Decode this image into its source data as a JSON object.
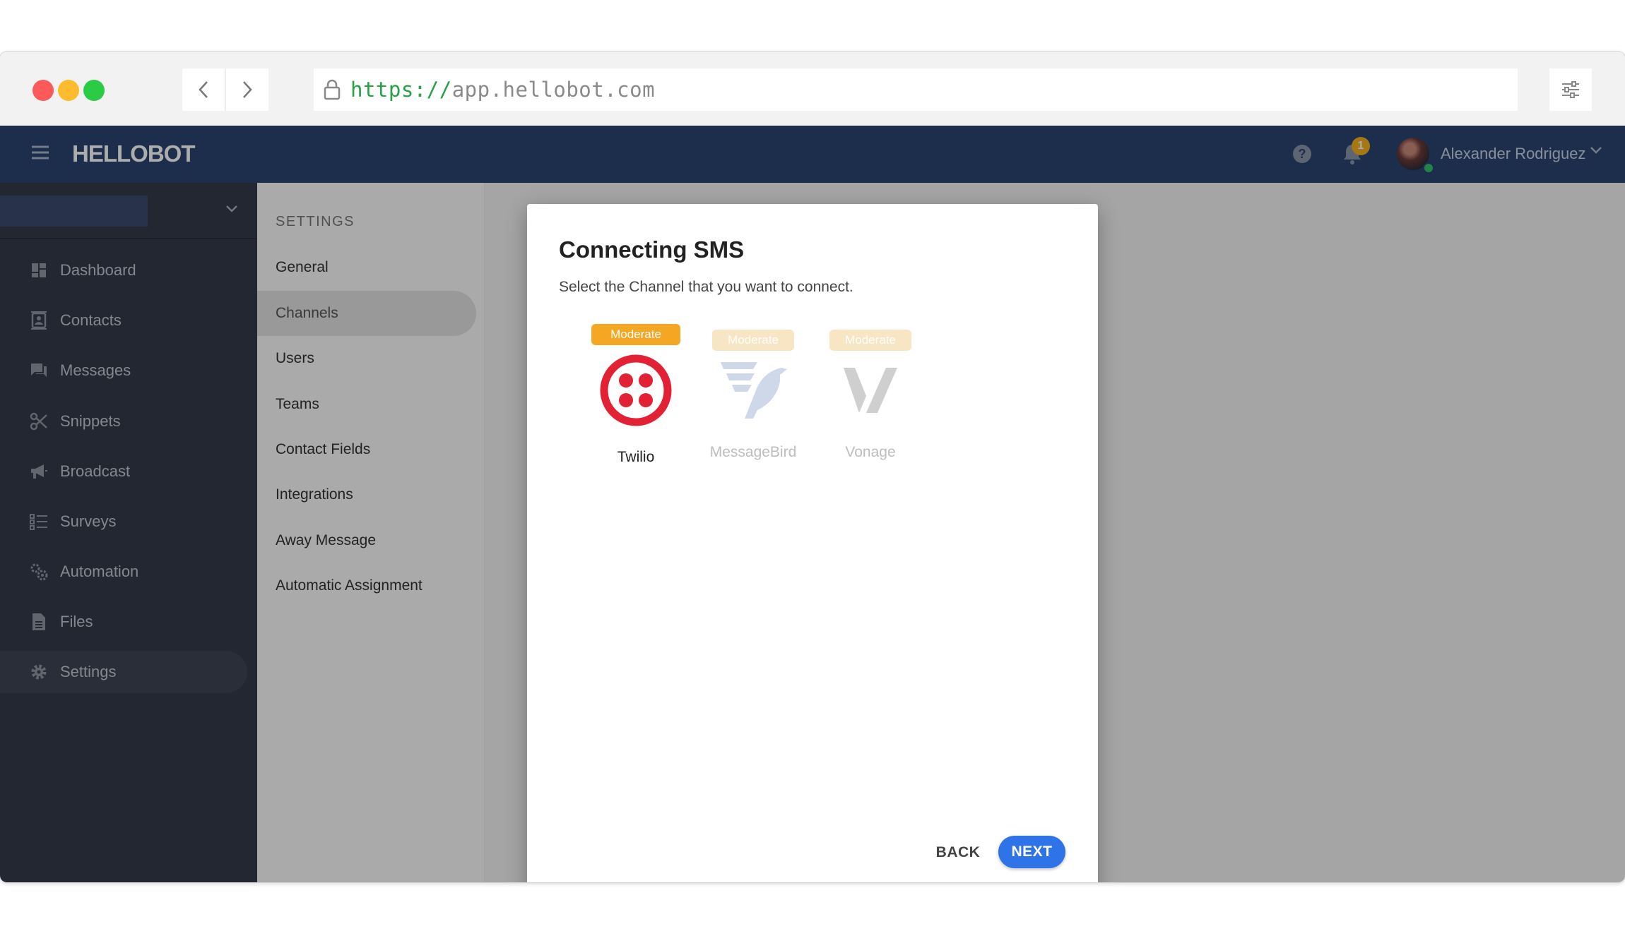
{
  "browser": {
    "url_scheme": "https://",
    "url_rest": "app.hellobot.com"
  },
  "header": {
    "logo": "HELLOBOT",
    "notification_count": "1",
    "user_name": "Alexander Rodriguez"
  },
  "sidebar": {
    "items": [
      {
        "label": "Dashboard",
        "icon": "dashboard-icon"
      },
      {
        "label": "Contacts",
        "icon": "contacts-icon"
      },
      {
        "label": "Messages",
        "icon": "messages-icon"
      },
      {
        "label": "Snippets",
        "icon": "scissors-icon"
      },
      {
        "label": "Broadcast",
        "icon": "megaphone-icon"
      },
      {
        "label": "Surveys",
        "icon": "list-icon"
      },
      {
        "label": "Automation",
        "icon": "cogs-icon"
      },
      {
        "label": "Files",
        "icon": "file-icon"
      },
      {
        "label": "Settings",
        "icon": "gear-icon",
        "active": true
      }
    ]
  },
  "settings_nav": {
    "title": "SETTINGS",
    "items": [
      "General",
      "Channels",
      "Users",
      "Teams",
      "Contact Fields",
      "Integrations",
      "Away Message",
      "Automatic Assignment"
    ],
    "active": "Channels"
  },
  "modal": {
    "title": "Connecting SMS",
    "subtitle": "Select the Channel that you want to connect.",
    "channels": [
      {
        "name": "Twilio",
        "badge": "Moderate",
        "selected": true
      },
      {
        "name": "MessageBird",
        "badge": "Moderate",
        "selected": false
      },
      {
        "name": "Vonage",
        "badge": "Moderate",
        "selected": false
      }
    ],
    "back_label": "BACK",
    "next_label": "NEXT"
  },
  "colors": {
    "header": "#2a4470",
    "sidebar": "#343a4a",
    "accent": "#2f73e8",
    "badge": "#f5a623",
    "twilio": "#e22134"
  }
}
